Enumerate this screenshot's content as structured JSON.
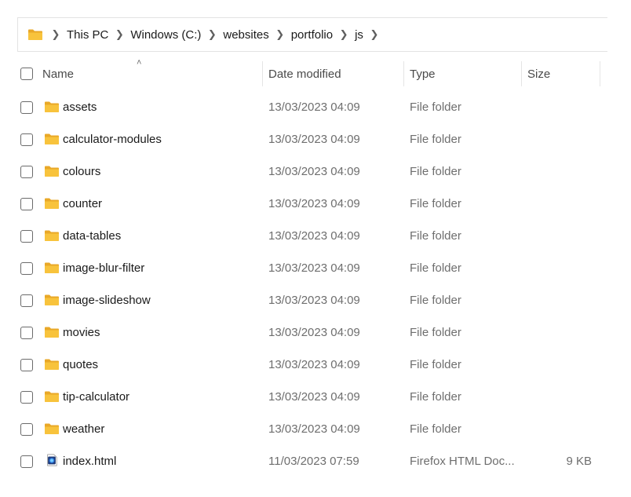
{
  "breadcrumb": [
    "This PC",
    "Windows (C:)",
    "websites",
    "portfolio",
    "js"
  ],
  "columns": {
    "name": "Name",
    "date": "Date modified",
    "type": "Type",
    "size": "Size"
  },
  "sort": {
    "column": "name",
    "direction": "ascending"
  },
  "colors": {
    "folder_body": "#f8c33c",
    "folder_tab": "#e9a828",
    "html_icon_bg": "#1f3b7a"
  },
  "files": [
    {
      "name": "assets",
      "date": "13/03/2023 04:09",
      "type": "File folder",
      "size": "",
      "icon": "folder-icon"
    },
    {
      "name": "calculator-modules",
      "date": "13/03/2023 04:09",
      "type": "File folder",
      "size": "",
      "icon": "folder-icon"
    },
    {
      "name": "colours",
      "date": "13/03/2023 04:09",
      "type": "File folder",
      "size": "",
      "icon": "folder-icon"
    },
    {
      "name": "counter",
      "date": "13/03/2023 04:09",
      "type": "File folder",
      "size": "",
      "icon": "folder-icon"
    },
    {
      "name": "data-tables",
      "date": "13/03/2023 04:09",
      "type": "File folder",
      "size": "",
      "icon": "folder-icon"
    },
    {
      "name": "image-blur-filter",
      "date": "13/03/2023 04:09",
      "type": "File folder",
      "size": "",
      "icon": "folder-icon"
    },
    {
      "name": "image-slideshow",
      "date": "13/03/2023 04:09",
      "type": "File folder",
      "size": "",
      "icon": "folder-icon"
    },
    {
      "name": "movies",
      "date": "13/03/2023 04:09",
      "type": "File folder",
      "size": "",
      "icon": "folder-icon"
    },
    {
      "name": "quotes",
      "date": "13/03/2023 04:09",
      "type": "File folder",
      "size": "",
      "icon": "folder-icon"
    },
    {
      "name": "tip-calculator",
      "date": "13/03/2023 04:09",
      "type": "File folder",
      "size": "",
      "icon": "folder-icon"
    },
    {
      "name": "weather",
      "date": "13/03/2023 04:09",
      "type": "File folder",
      "size": "",
      "icon": "folder-icon"
    },
    {
      "name": "index.html",
      "date": "11/03/2023 07:59",
      "type": "Firefox HTML Doc...",
      "size": "9 KB",
      "icon": "html-file-icon"
    }
  ]
}
